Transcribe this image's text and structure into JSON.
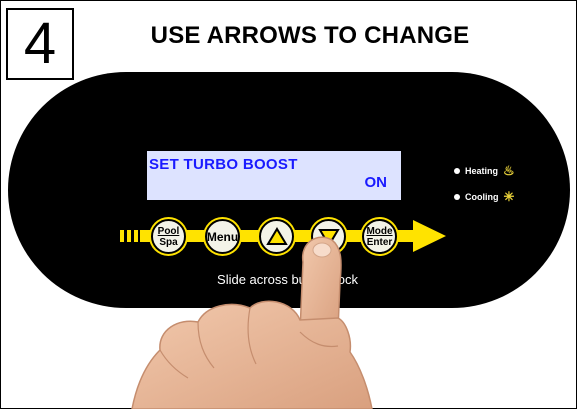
{
  "step": {
    "number": "4"
  },
  "headline": "USE ARROWS TO CHANGE",
  "display": {
    "line1": "SET TURBO BOOST",
    "line2": "ON"
  },
  "indicators": [
    {
      "label": "Heating",
      "icon": "heating-icon"
    },
    {
      "label": "Cooling",
      "icon": "cooling-icon"
    }
  ],
  "buttons": {
    "pool_spa": {
      "top": "Pool",
      "bottom": "Spa"
    },
    "menu": "Menu",
    "up": "up-arrow-icon",
    "down": "down-arrow-icon",
    "mode_enter": {
      "top": "Mode",
      "bottom": "Enter"
    }
  },
  "slide_hint": "Slide across bu       o unlock",
  "colors": {
    "panel": "#000000",
    "lcd_background": "#dde3ff",
    "lcd_text": "#1a1aff",
    "accent_yellow": "#ffe300"
  }
}
